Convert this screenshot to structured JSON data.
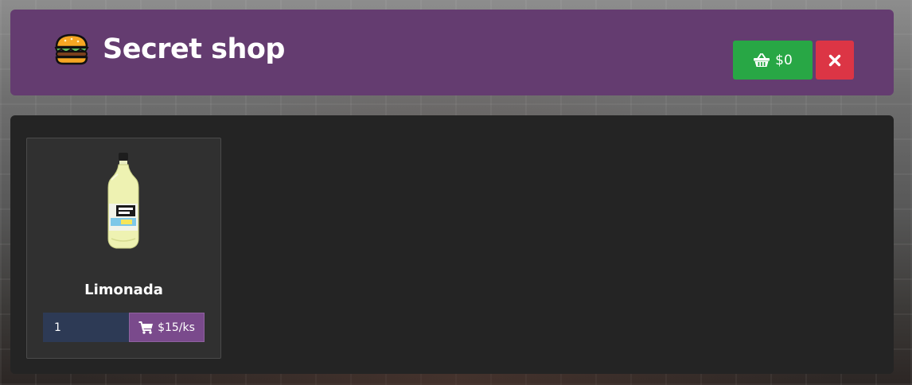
{
  "header": {
    "title": "Secret shop",
    "icon": "burger-icon",
    "basket_label": "$0",
    "basket_icon": "basket-icon",
    "close_icon": "close-icon"
  },
  "colors": {
    "header_bg": "#643c70",
    "panel_bg": "#242424",
    "card_bg": "#303030",
    "basket_button": "#28a745",
    "close_button": "#dc3545",
    "qty_input_bg": "#2d3a55",
    "buy_button": "#7a4a8c"
  },
  "items": [
    {
      "name": "Limonada",
      "image_icon": "lemonade-bottle-icon",
      "quantity": "1",
      "price_label": "$15/ks",
      "cart_icon": "cart-icon"
    }
  ]
}
